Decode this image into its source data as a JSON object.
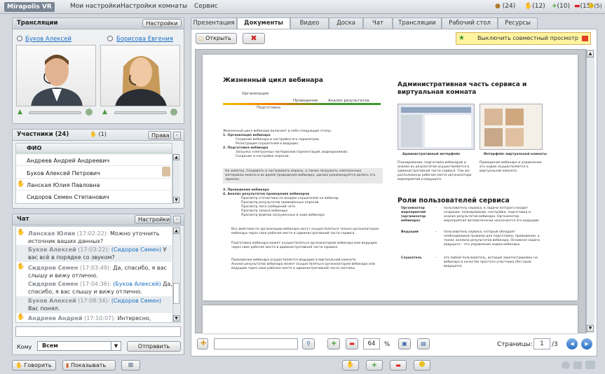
{
  "app": {
    "logo": "Mirapolis VR",
    "menu": [
      "Мои настройки",
      "Настройки комнаты",
      "Сервис"
    ]
  },
  "status": {
    "users": "(24)",
    "hands": "(12)",
    "plus": "(10)",
    "minus": "(15)",
    "smile": "(5)"
  },
  "broadcast": {
    "title": "Трансляции",
    "settings": "Настройки",
    "speaker1": "Буков Алексей",
    "speaker2": "Борисова Евгения"
  },
  "participants": {
    "title": "Участники (24)",
    "hands": "(1)",
    "rights": "Права",
    "column": "ФИО",
    "rows": [
      "Андреев Андрей Андреевич",
      "Буков Алексей Петрович",
      "Ланская Юлия Павловна",
      "Сидоров Семен Степанович"
    ]
  },
  "chat": {
    "title": "Чат",
    "settings": "Настройки",
    "messages": [
      {
        "name": "Ланская Юлия",
        "time": " (17:02:22): ",
        "text": "Можно уточнить источник ваших данных?"
      },
      {
        "name": "Буков Алексей",
        "time": " (17:03:22): ",
        "to": "(Сидоров Семен)",
        "text": " У вас всё в порядке со звуком?"
      },
      {
        "name": "Сидоров Семен",
        "time": " (17:03:49): ",
        "text": "Да, спасибо, я вас слышу и вижу отлично."
      },
      {
        "name": "Сидоров Семен",
        "time": " (17:04:36): ",
        "to": "(Буков Алексей)",
        "text": " Да, спасибо, я вас слышу и вижу отлично."
      },
      {
        "name": "Буков Алексей",
        "time": " (17:08:34): ",
        "to": "(Сидоров Семен)",
        "text": " Вас понял."
      },
      {
        "name": "Андреев Андрей",
        "time": " (17:10:07): ",
        "text": "Интересно,"
      }
    ],
    "to_label": "Кому",
    "to_value": "Всем",
    "send": "Отправить"
  },
  "bottom": {
    "speak": "Говорить",
    "show": "Показывать"
  },
  "tabs": [
    "Презентация",
    "Документы",
    "Видео",
    "Доска",
    "Чат",
    "Трансляции",
    "Рабочий стол",
    "Ресурсы"
  ],
  "doc": {
    "open": "Открыть",
    "shared": "Выключить совместный просмотр",
    "zoom": "64",
    "percent": "%",
    "pages_label": "Страницы:",
    "page": "1",
    "total": "/3"
  },
  "slide": {
    "left_title": "Жизненный цикл вебинара",
    "stage1": "Организация",
    "stage2": "Подготовка",
    "stage3": "Проведение",
    "stage4": "Анализ результатов",
    "intro": "Жизненный цикл вебинара включает в себя следующие этапы:",
    "i1": "1. Организация вебинара",
    "i1a": "Создание вебинара и настройка его параметров.",
    "i1b": "Регистрация слушателей и ведущих.",
    "i2": "2. Подготовка вебинара",
    "i2a": "Загрузка электронных материалов (презентаций, видеороликов).",
    "i2b": "Создание и настройка опросов.",
    "note": "На заметку. Создавать и настраивать опросы, а также загружать электронные материалы можно и во время проведения вебинара, однако рекомендуется делать это заранее.",
    "i3": "3. Проведение вебинара",
    "i4": "4. Анализ результатов проведения вебинаров",
    "i4a": "Просмотр статистики по входам слушателей на вебинар",
    "i4b": "Просмотр результатов проведенных опросов",
    "i4c": "Просмотр лога сообщений чата",
    "i4d": "Просмотр записи вебинара",
    "i4e": "Просмотр файлов загруженных в ходе вебинара",
    "b1": "Все действия по организации вебинара могут осуществляться только организатором вебинара через свое рабочее место в административной части сервиса.",
    "b2": "Подготовка вебинара может осуществляться организатором вебинара или ведущим через свое рабочее место в административной части сервиса.",
    "b3": "Проведение вебинара осуществляется ведущим в виртуальной комнате.",
    "b4": "Анализ результатов вебинара может осуществляться организатором вебинара или ведущим через свое рабочее место в административной части системы.",
    "right_title": "Административная часть сервиса и виртуальная комната",
    "cap1": "Административный интерфейс",
    "cap2": "Интерфейс виртуальной комнаты",
    "desc1": "Планирование, подготовка вебинаров и анализ их результатов осуществляются в административной части сервиса. Там же расположены рабочие места организатора мероприятий и ведущего.",
    "desc2": "Проведение вебинара и управление его ходом осуществляется в виртуальной комнате.",
    "roles_title": "Роли пользователей сервиса",
    "r1": "Организатор мероприятий (организатор вебинара)",
    "r1d": "пользователь сервиса, в задачи которого входит создание, планирование, настройка, подготовка и анализ результатов вебинара. Организатор мероприятия автоматически назначается его ведущим.",
    "r2": "Ведущий",
    "r2d": "пользователь сервиса, который обладает необходимыми правами для подготовки, проведения, а также анализа результатов вебинара. Основная задача ведущего – это управление ходом вебинара.",
    "r3": "Слушатель",
    "r3d": "это любой пользователь, который зарегистрирован на вебинаре в качестве простого участника (без прав ведущего).",
    "dash": "–"
  }
}
